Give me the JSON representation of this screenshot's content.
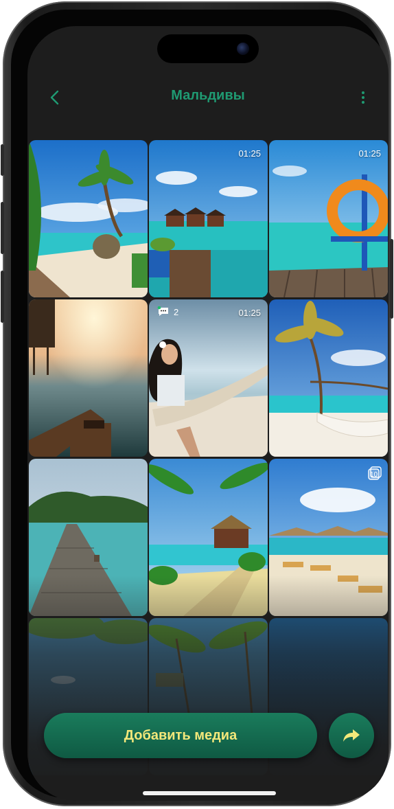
{
  "header": {
    "title": "Мальдивы",
    "back_icon": "chevron-left-icon",
    "more_icon": "more-vertical-icon"
  },
  "gallery": {
    "tiles": [
      {
        "scene": "palm-hammock-swing-beach",
        "duration": "",
        "comments": "",
        "multi": ""
      },
      {
        "scene": "overwater-villas-lagoon",
        "duration": "01:25",
        "comments": "",
        "multi": ""
      },
      {
        "scene": "lifebuoy-pier",
        "duration": "01:25",
        "comments": "",
        "multi": ""
      },
      {
        "scene": "sunset-water-deck",
        "duration": "",
        "comments": "",
        "multi": ""
      },
      {
        "scene": "woman-in-hammock",
        "duration": "01:25",
        "comments": "2",
        "multi": ""
      },
      {
        "scene": "leaning-palm-hammock",
        "duration": "",
        "comments": "",
        "multi": ""
      },
      {
        "scene": "wooden-jetty-island",
        "duration": "",
        "comments": "",
        "multi": ""
      },
      {
        "scene": "palms-hut-villas",
        "duration": "",
        "comments": "",
        "multi": ""
      },
      {
        "scene": "beach-umbrellas-loungers",
        "duration": "",
        "comments": "",
        "multi": "10"
      },
      {
        "scene": "palm-reflection",
        "duration": "",
        "comments": "",
        "multi": ""
      },
      {
        "scene": "palms-dusk",
        "duration": "",
        "comments": "",
        "multi": ""
      },
      {
        "scene": "dark-sea",
        "duration": "",
        "comments": "",
        "multi": ""
      }
    ]
  },
  "actions": {
    "add_media_label": "Добавить медиа",
    "share_icon": "share-arrow-icon"
  },
  "colors": {
    "accent": "#1f9a72",
    "button_bg": "#0f5a43",
    "button_text": "#f3e87a",
    "screen_bg": "#1d1d1d"
  }
}
